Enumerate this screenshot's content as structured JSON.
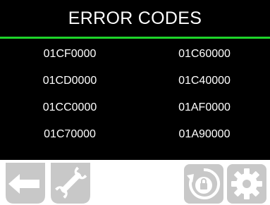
{
  "header": {
    "title": "ERROR CODES",
    "accent_color": "#1ed42a"
  },
  "error_codes": {
    "rows": [
      {
        "left": "01CF0000",
        "right": "01C60000"
      },
      {
        "left": "01CD0000",
        "right": "01C40000"
      },
      {
        "left": "01CC0000",
        "right": "01AF0000"
      },
      {
        "left": "01C70000",
        "right": "01A90000"
      }
    ]
  },
  "toolbar": {
    "icons": [
      "back-arrow-icon",
      "wrench-icon",
      "lock-reset-icon",
      "gear-icon"
    ],
    "icon_color": "#c8c8c8"
  }
}
